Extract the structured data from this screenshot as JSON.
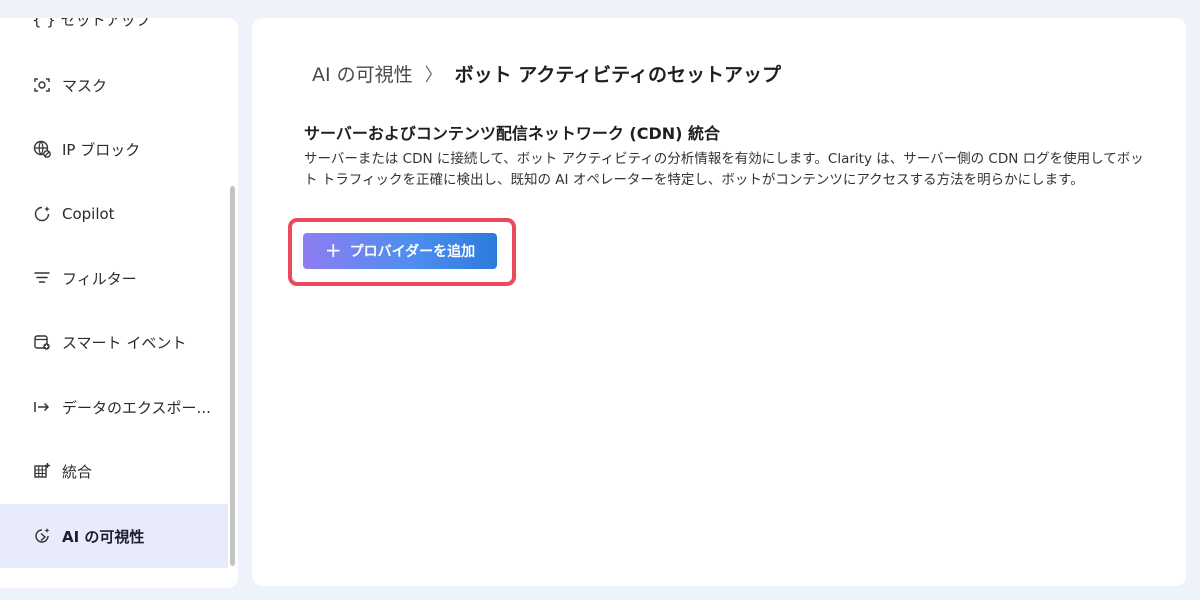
{
  "sidebar": {
    "partial_item": "{ } セットアップ",
    "items": [
      {
        "label": "マスク",
        "icon": "mask-icon"
      },
      {
        "label": "IP ブロック",
        "icon": "globe-block-icon"
      },
      {
        "label": "Copilot",
        "icon": "copilot-icon"
      },
      {
        "label": "フィルター",
        "icon": "filter-icon"
      },
      {
        "label": "スマート イベント",
        "icon": "smart-event-icon"
      },
      {
        "label": "データのエクスポー...",
        "icon": "export-icon"
      },
      {
        "label": "統合",
        "icon": "integration-icon"
      },
      {
        "label": "AI の可視性",
        "icon": "ai-visibility-icon",
        "active": true
      }
    ]
  },
  "breadcrumb": {
    "parent": "AI の可視性",
    "separator": "〉",
    "current": "ボット アクティビティのセットアップ"
  },
  "section": {
    "title": "サーバーおよびコンテンツ配信ネットワーク (CDN) 統合",
    "description": "サーバーまたは CDN に接続して、ボット アクティビティの分析情報を有効にします。Clarity は、サーバー側の CDN ログを使用してボット トラフィックを正確に検出し、既知の AI オペレーターを特定し、ボットがコンテンツにアクセスする方法を明らかにします。"
  },
  "add_provider_button": {
    "icon_glyph": "+",
    "label": "プロバイダーを追加"
  },
  "colors": {
    "highlight": "#ea4a5c",
    "button_gradient_start": "#8f7cf2",
    "button_gradient_end": "#2c7bdc",
    "active_item_bg": "#e8ebfa"
  }
}
